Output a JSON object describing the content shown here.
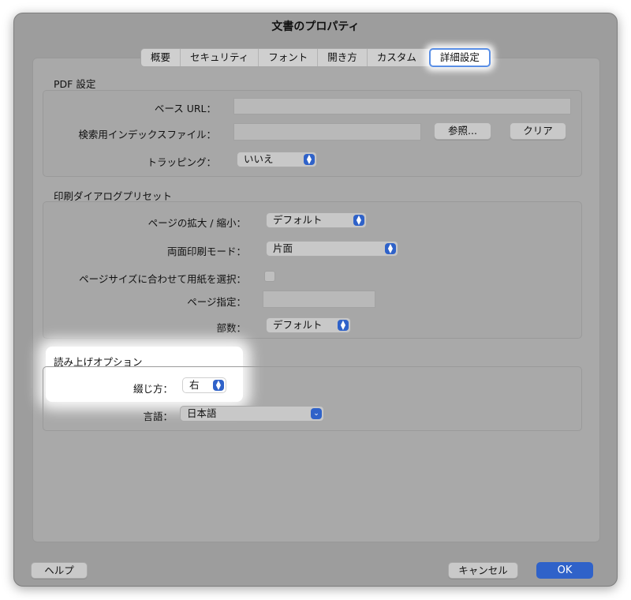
{
  "window": {
    "title": "文書のプロパティ"
  },
  "tabs": [
    {
      "label": "概要"
    },
    {
      "label": "セキュリティ"
    },
    {
      "label": "フォント"
    },
    {
      "label": "開き方"
    },
    {
      "label": "カスタム"
    },
    {
      "label": "詳細設定"
    }
  ],
  "pdf_settings": {
    "title": "PDF 設定",
    "base_url_label": "ベース URL：",
    "base_url_value": "",
    "search_index_label": "検索用インデックスファイル：",
    "search_index_value": "",
    "browse_label": "参照...",
    "clear_label": "クリア",
    "trapping_label": "トラッピング：",
    "trapping_value": "いいえ"
  },
  "print_presets": {
    "title": "印刷ダイアログプリセット",
    "page_scaling_label": "ページの拡大 / 縮小：",
    "page_scaling_value": "デフォルト",
    "duplex_label": "両面印刷モード：",
    "duplex_value": "片面",
    "paper_by_size_label": "ページサイズに合わせて用紙を選択：",
    "page_range_label": "ページ指定：",
    "page_range_value": "",
    "copies_label": "部数：",
    "copies_value": "デフォルト"
  },
  "reading_options": {
    "title": "読み上げオプション",
    "binding_label": "綴じ方：",
    "binding_value": "右",
    "language_label": "言語：",
    "language_value": "日本語"
  },
  "footer": {
    "help_label": "ヘルプ",
    "cancel_label": "キャンセル",
    "ok_label": "OK"
  },
  "colors": {
    "accent": "#2f62c9",
    "tab_focus_ring": "#5a8fe6"
  }
}
